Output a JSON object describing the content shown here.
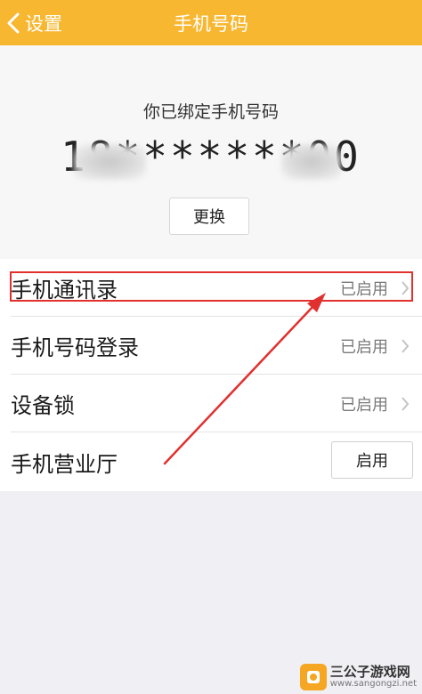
{
  "nav": {
    "back_label": "设置",
    "title": "手机号码"
  },
  "binding": {
    "label": "你已绑定手机号码",
    "masked_number": "18*******00",
    "change_button": "更换"
  },
  "list": [
    {
      "label": "手机通讯录",
      "status": "已启用"
    },
    {
      "label": "手机号码登录",
      "status": "已启用"
    },
    {
      "label": "设备锁",
      "status": "已启用"
    },
    {
      "label": "手机营业厅",
      "button": "启用"
    }
  ],
  "watermark": {
    "title": "三公子游戏网",
    "url": "www.sangongzi.net"
  },
  "colors": {
    "nav_bg": "#f7b731",
    "annotation": "#e0312f",
    "page_bg": "#efeff4"
  }
}
